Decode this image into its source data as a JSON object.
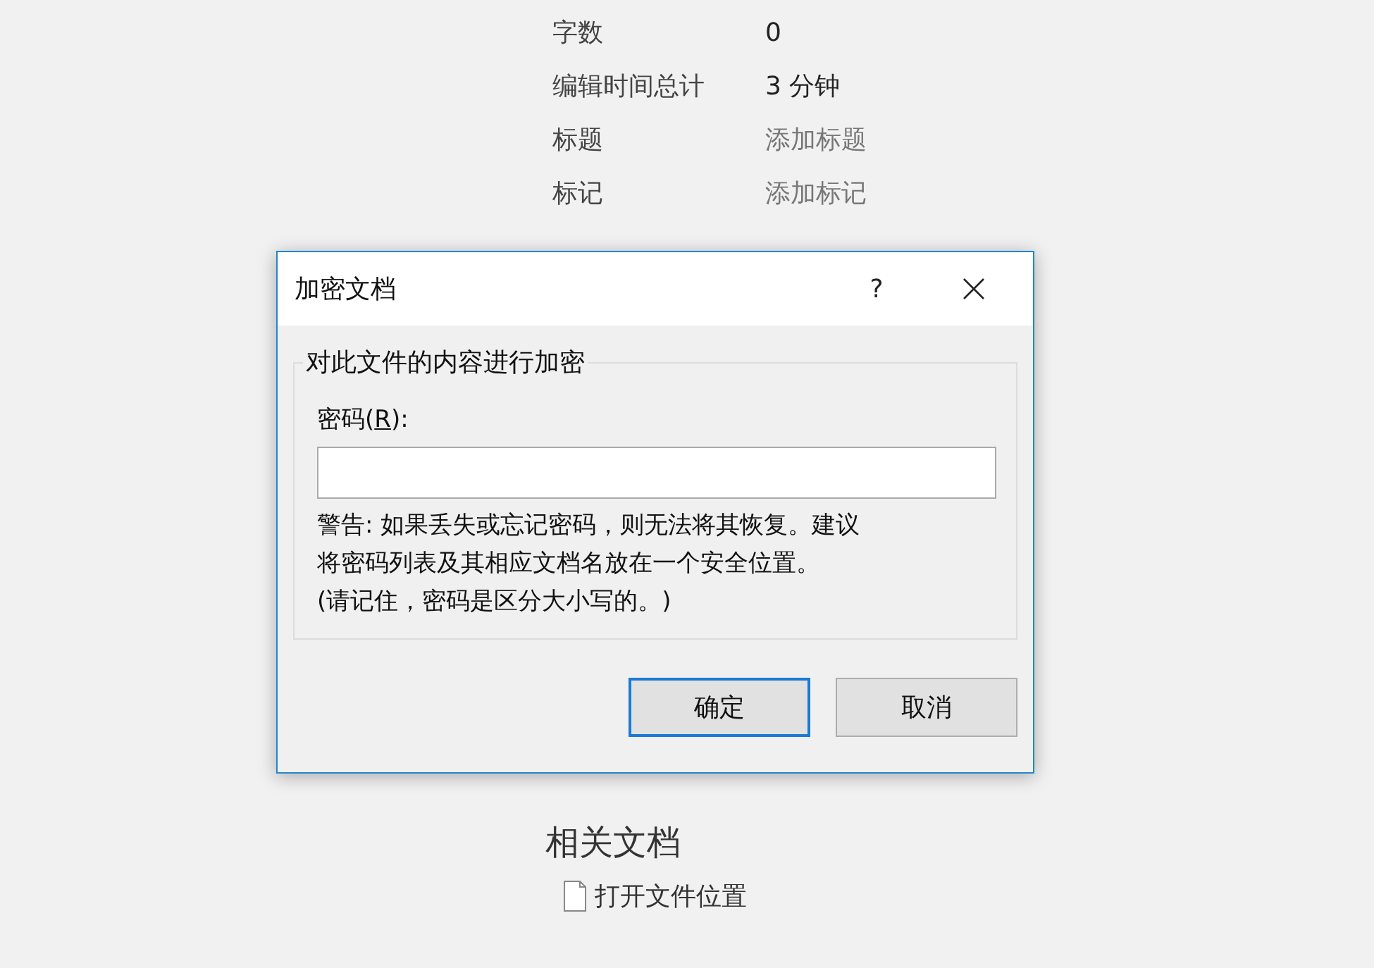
{
  "properties": [
    {
      "label": "字数",
      "value": "0",
      "kind": "plain"
    },
    {
      "label": "编辑时间总计",
      "value": "3 分钟",
      "kind": "plain"
    },
    {
      "label": "标题",
      "value": "添加标题",
      "kind": "placeholder"
    },
    {
      "label": "标记",
      "value": "添加标记",
      "kind": "placeholder"
    }
  ],
  "related_documents": {
    "heading": "相关文档",
    "items": [
      "打开文件位置"
    ]
  },
  "dialog": {
    "title": "加密文档",
    "help": "?",
    "group_title": "对此文件的内容进行加密",
    "password_label": {
      "before": "密码(",
      "access_key": "R",
      "after": "):"
    },
    "warning": [
      "警告: 如果丢失或忘记密码，则无法将其恢复。建议",
      "将密码列表及其相应文档名放在一个安全位置。",
      "(请记住，密码是区分大小写的。)"
    ],
    "buttons": [
      {
        "label": "确定",
        "default": true
      },
      {
        "label": "取消",
        "default": false
      }
    ]
  }
}
